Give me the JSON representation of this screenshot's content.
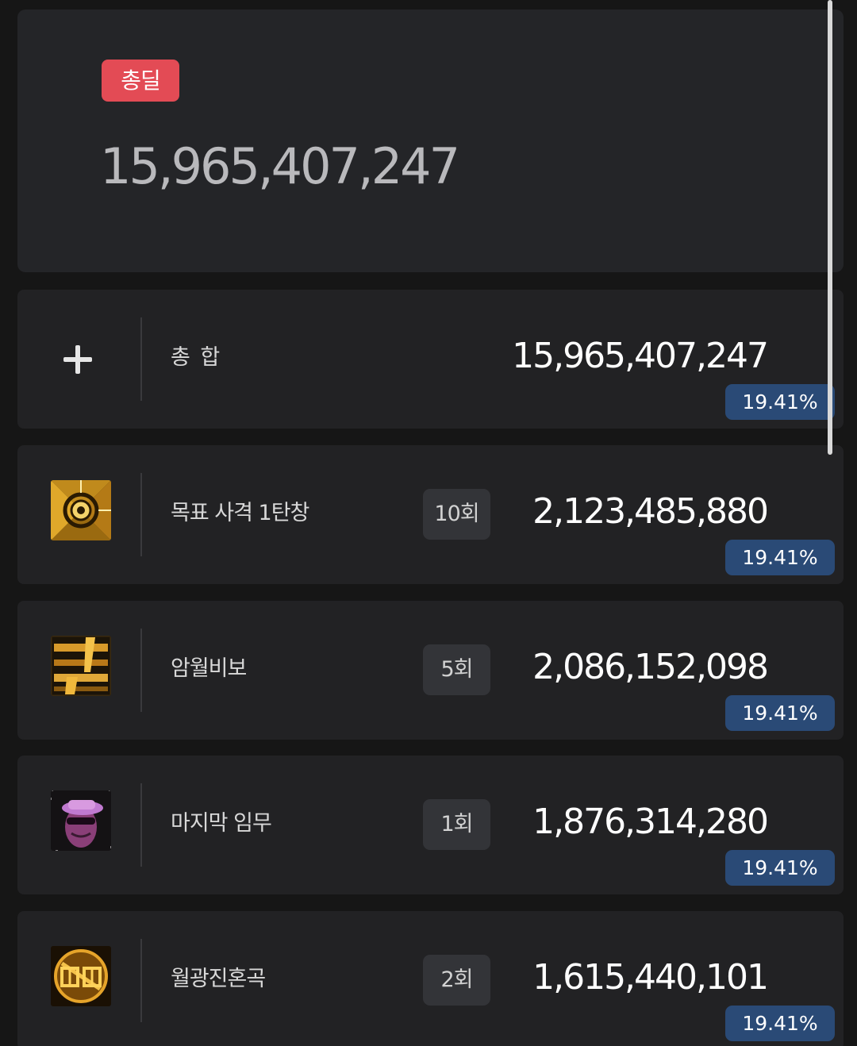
{
  "summary": {
    "badge_label": "총딜",
    "total_damage": "15,965,407,247"
  },
  "rows": [
    {
      "icon": "plus-icon",
      "name": "총 합",
      "hits": "",
      "damage": "15,965,407,247",
      "percent": "19.41%"
    },
    {
      "icon": "target-shot-skill-icon",
      "name": "목표 사격 1탄창",
      "hits": "10회",
      "damage": "2,123,485,880",
      "percent": "19.41%"
    },
    {
      "icon": "dark-moon-secret-skill-icon",
      "name": "암월비보",
      "hits": "5회",
      "damage": "2,086,152,098",
      "percent": "19.41%"
    },
    {
      "icon": "last-mission-skill-icon",
      "name": "마지막 임무",
      "hits": "1회",
      "damage": "1,876,314,280",
      "percent": "19.41%"
    },
    {
      "icon": "moonlight-requiem-skill-icon",
      "name": "월광진혼곡",
      "hits": "2회",
      "damage": "1,615,440,101",
      "percent": "19.41%"
    }
  ],
  "colors": {
    "total_badge": "#e34b55",
    "percent_badge": "#2a4a76",
    "card_background": "#242528",
    "row_background": "#222224"
  }
}
